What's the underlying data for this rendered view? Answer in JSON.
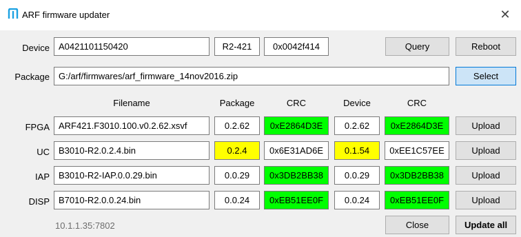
{
  "window": {
    "title": "ARF firmware updater",
    "icon": "arf-logo-icon",
    "close_icon": "close-icon",
    "close_glyph": "✕",
    "accent": "#0078d7"
  },
  "device": {
    "label": "Device",
    "serial": "A0421101150420",
    "model": "R2-421",
    "id": "0x0042f414",
    "query_label": "Query",
    "reboot_label": "Reboot"
  },
  "package": {
    "label": "Package",
    "path": "G:/arf/firmwares/arf_firmware_14nov2016.zip",
    "select_label": "Select"
  },
  "columns": {
    "filename": "Filename",
    "package": "Package",
    "crc1": "CRC",
    "device": "Device",
    "crc2": "CRC"
  },
  "rows": [
    {
      "label": "FPGA",
      "filename": "ARF421.F3010.100.v0.2.62.xsvf",
      "pkg_version": "0.2.62",
      "pkg_crc": "0xE2864D3E",
      "dev_version": "0.2.62",
      "dev_crc": "0xE2864D3E",
      "upload_label": "Upload"
    },
    {
      "label": "UC",
      "filename": "B3010-R2.0.2.4.bin",
      "pkg_version": "0.2.4",
      "pkg_crc": "0x6E31AD6E",
      "dev_version": "0.1.54",
      "dev_crc": "0xEE1C57EE",
      "upload_label": "Upload"
    },
    {
      "label": "IAP",
      "filename": "B3010-R2-IAP.0.0.29.bin",
      "pkg_version": "0.0.29",
      "pkg_crc": "0x3DB2BB38",
      "dev_version": "0.0.29",
      "dev_crc": "0x3DB2BB38",
      "upload_label": "Upload"
    },
    {
      "label": "DISP",
      "filename": "B7010-R2.0.0.24.bin",
      "pkg_version": "0.0.24",
      "pkg_crc": "0xEB51EE0F",
      "dev_version": "0.0.24",
      "dev_crc": "0xEB51EE0F",
      "upload_label": "Upload"
    }
  ],
  "footer": {
    "address": "10.1.1.35:7802",
    "close_label": "Close",
    "update_all_label": "Update all"
  },
  "colors": {
    "match": "#00ff00",
    "mismatch": "#ffff00",
    "select_button": "#cce4f7"
  }
}
